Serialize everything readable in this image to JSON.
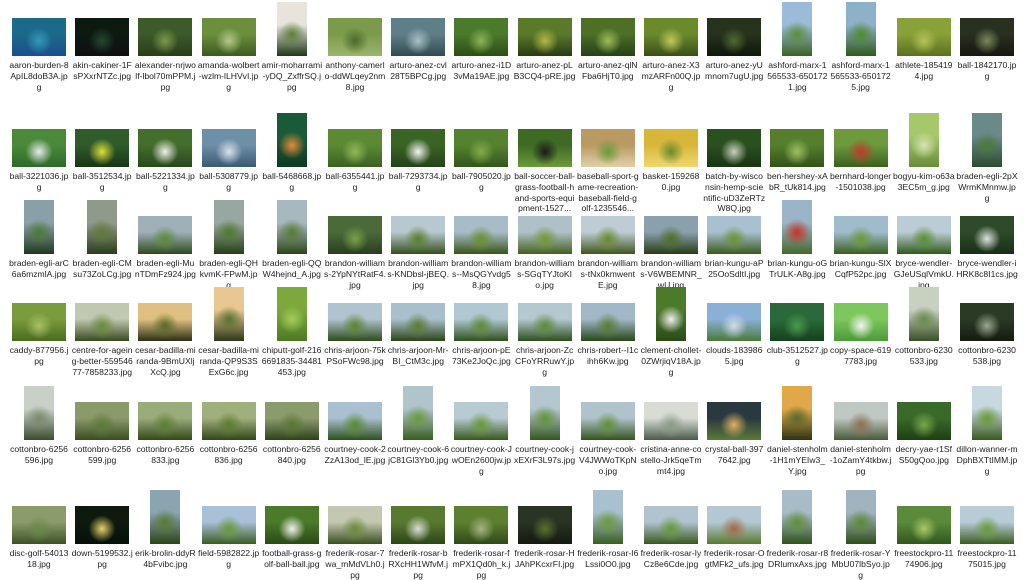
{
  "window": {
    "title": ""
  },
  "files": [
    [
      {
        "name": "aaron-burden-8ApIL8doB3A.jpg",
        "c": [
          "#1b6a8a",
          "#2f9bb8",
          "#1d4d8c"
        ],
        "o": "l"
      },
      {
        "name": "akin-cakiner-1FsPXxrNTZc.jpg",
        "c": [
          "#0c1a12",
          "#234830",
          "#0e0f10"
        ],
        "o": "l"
      },
      {
        "name": "alexander-nrjwolf-lbol70mPPM.jpg",
        "c": [
          "#3c5a2a",
          "#7b9a4a",
          "#2a3d1a"
        ],
        "o": "l"
      },
      {
        "name": "amanda-wolbert-wzlm-lLHVvI.jpg",
        "c": [
          "#6c8f3d",
          "#b5c98a",
          "#3d5a20"
        ],
        "o": "l"
      },
      {
        "name": "amir-moharrami-yDQ_ZxffrSQ.jpg",
        "c": [
          "#e8e4dc",
          "#5e7f3b",
          "#203818"
        ],
        "o": "p"
      },
      {
        "name": "anthony-camerlo-ddWLqey2nm8.jpg",
        "c": [
          "#7c9a4c",
          "#4a6a2a",
          "#9bb56c"
        ],
        "o": "l"
      },
      {
        "name": "arturo-anez-cvl28T5BPCg.jpg",
        "c": [
          "#5f7f88",
          "#a9c1c7",
          "#314a50"
        ],
        "o": "l"
      },
      {
        "name": "arturo-anez-i1D3vMa19AE.jpg",
        "c": [
          "#4a7a2a",
          "#8db45a",
          "#2e4d16"
        ],
        "o": "l"
      },
      {
        "name": "arturo-anez-pLB3CQ4-pRE.jpg",
        "c": [
          "#5a7a2a",
          "#b3b84a",
          "#2a3a14"
        ],
        "o": "l"
      },
      {
        "name": "arturo-anez-qlNFba6HjT0.jpg",
        "c": [
          "#4d6f26",
          "#9fbd5a",
          "#26401a"
        ],
        "o": "l"
      },
      {
        "name": "arturo-anez-X3mzARFn00Q.jpg",
        "c": [
          "#6b8a2c",
          "#c1c85a",
          "#3a4d1a"
        ],
        "o": "l"
      },
      {
        "name": "arturo-anez-yUmnom7ugU.jpg",
        "c": [
          "#27331c",
          "#4e6a2e",
          "#0f160b"
        ],
        "o": "l"
      },
      {
        "name": "ashford-marx-1565533-6501721.jpg",
        "c": [
          "#9bbbd8",
          "#5c8d3a",
          "#3a6224"
        ],
        "o": "p"
      },
      {
        "name": "ashford-marx-1565533-6501725.jpg",
        "c": [
          "#8fb0c9",
          "#4f8a30",
          "#2f5a1c"
        ],
        "o": "p"
      },
      {
        "name": "athlete-1854194.jpg",
        "c": [
          "#8aa038",
          "#b7c25a",
          "#5a7020"
        ],
        "o": "l"
      },
      {
        "name": "ball-1842170.jpg",
        "c": [
          "#2a3020",
          "#7a8a58",
          "#15180f"
        ],
        "o": "l"
      }
    ],
    [
      {
        "name": "ball-3221036.jpg",
        "c": [
          "#4a8a3a",
          "#e6ecef",
          "#2f6a2a"
        ],
        "o": "l"
      },
      {
        "name": "ball-3512534.jpg",
        "c": [
          "#2f5c2a",
          "#d9e03a",
          "#1a3416"
        ],
        "o": "l"
      },
      {
        "name": "ball-5221334.jpg",
        "c": [
          "#446e2c",
          "#f0f0ea",
          "#29481a"
        ],
        "o": "l"
      },
      {
        "name": "ball-5308779.jpg",
        "c": [
          "#6e8fa8",
          "#d8e2ea",
          "#3a5a74"
        ],
        "o": "l"
      },
      {
        "name": "ball-5468668.jpg",
        "c": [
          "#1a5a38",
          "#e58a3a",
          "#0e3a22"
        ],
        "o": "p"
      },
      {
        "name": "ball-6355441.jpg",
        "c": [
          "#5c8a34",
          "#8fb85a",
          "#3c6020"
        ],
        "o": "l"
      },
      {
        "name": "ball-7293734.jpg",
        "c": [
          "#3a6424",
          "#f4f4f0",
          "#24421a"
        ],
        "o": "l"
      },
      {
        "name": "ball-7905020.jpg",
        "c": [
          "#55822e",
          "#83ab4c",
          "#33561c"
        ],
        "o": "l"
      },
      {
        "name": "ball-soccer-ball-grass-football-hand-sports-equipment-1527...",
        "c": [
          "#3e6a24",
          "#1a1a1a",
          "#6c9a3c"
        ],
        "o": "l"
      },
      {
        "name": "baseball-sport-game-recreation-baseball-field-golf-1235546...",
        "c": [
          "#b89a62",
          "#6a9a3a",
          "#e0d0a6"
        ],
        "o": "l"
      },
      {
        "name": "basket-1592680.jpg",
        "c": [
          "#d8b63a",
          "#6a8a2a",
          "#f0d870"
        ],
        "o": "l"
      },
      {
        "name": "batch-by-wisconsin-hemp-scientific-uD3ZeRTzW8Q.jpg",
        "c": [
          "#2a5020",
          "#c8d0c0",
          "#183414"
        ],
        "o": "l"
      },
      {
        "name": "ben-hershey-xAbR_tUk814.jpg",
        "c": [
          "#567e2c",
          "#9ec064",
          "#34521a"
        ],
        "o": "l"
      },
      {
        "name": "bernhard-longer-1501038.jpg",
        "c": [
          "#6c9a3c",
          "#c23a2a",
          "#3c6020"
        ],
        "o": "l"
      },
      {
        "name": "bogyu-kim-o63a3EC5m_g.jpg",
        "c": [
          "#a6c86a",
          "#d6e6b0",
          "#6a8c3a"
        ],
        "o": "p"
      },
      {
        "name": "braden-egli-2pXWrmKMnmw.jpg",
        "c": [
          "#6a8a8a",
          "#4a7a3a",
          "#2c4a2c"
        ],
        "o": "p"
      }
    ],
    [
      {
        "name": "braden-egli-arC6a6mzmlA.jpg",
        "c": [
          "#8aa0a8",
          "#4c7a34",
          "#203820"
        ],
        "o": "p"
      },
      {
        "name": "braden-egli-CMsu73ZoLCg.jpg",
        "c": [
          "#909a8a",
          "#5e7a3a",
          "#2a3c1c"
        ],
        "o": "p"
      },
      {
        "name": "braden-egli-MunTDmFz924.jpg",
        "c": [
          "#a0b0b8",
          "#5e8a3c",
          "#2e4a1c"
        ],
        "o": "l"
      },
      {
        "name": "braden-egli-QHkvmK-FPwM.jpg",
        "c": [
          "#98a8a0",
          "#4e7a30",
          "#263e18"
        ],
        "o": "p"
      },
      {
        "name": "braden-egli-QQW4hejnd_A.jpg",
        "c": [
          "#a8b8c0",
          "#567c32",
          "#2c461a"
        ],
        "o": "p"
      },
      {
        "name": "brandon-williams-2YpNYtRatF4.jpg",
        "c": [
          "#4a6a3a",
          "#7aa04c",
          "#2a3e1e"
        ],
        "o": "l"
      },
      {
        "name": "brandon-williams-KNDbsl-jBEQ.jpg",
        "c": [
          "#b8c8d0",
          "#5a7e2e",
          "#34501a"
        ],
        "o": "l"
      },
      {
        "name": "brandon-williams--MsQGYvdg58.jpg",
        "c": [
          "#a8bcc8",
          "#6a9030",
          "#3a5418"
        ],
        "o": "l"
      },
      {
        "name": "brandon-williams-SGqTYJtoKIo.jpg",
        "c": [
          "#b0c0c8",
          "#74983a",
          "#44601e"
        ],
        "o": "l"
      },
      {
        "name": "brandon-williams-tNx0kmwentE.jpg",
        "c": [
          "#c0ccd4",
          "#6a8a34",
          "#3e561c"
        ],
        "o": "l"
      },
      {
        "name": "brandon-williams-V6WBEMNR_wU.jpg",
        "c": [
          "#8aa0ac",
          "#4e6e2a",
          "#283c16"
        ],
        "o": "l"
      },
      {
        "name": "brian-kungu-aP25OoSdltI.jpg",
        "c": [
          "#a8c0d0",
          "#6a9438",
          "#3a5a1c"
        ],
        "o": "l"
      },
      {
        "name": "brian-kungu-oGTrULK-A8g.jpg",
        "c": [
          "#9ab4c8",
          "#c8302a",
          "#44682a"
        ],
        "o": "p"
      },
      {
        "name": "brian-kungu-SlXCqfP52pc.jpg",
        "c": [
          "#a0bccc",
          "#6c9a3c",
          "#3a5e20"
        ],
        "o": "l"
      },
      {
        "name": "bryce-wendler-GJeUSqlVmkU.jpg",
        "c": [
          "#bcccd6",
          "#5a8e34",
          "#2e5a1a"
        ],
        "o": "l"
      },
      {
        "name": "bryce-wendler-iHRK8c8I1cs.jpg",
        "c": [
          "#2e4a2a",
          "#dce4dc",
          "#1a2c18"
        ],
        "o": "l"
      }
    ],
    [
      {
        "name": "caddy-877956.jpg",
        "c": [
          "#7a9c3c",
          "#a8c064",
          "#4a6a20"
        ],
        "o": "l"
      },
      {
        "name": "centre-for-ageing-better-55954677-7858233.jpg",
        "c": [
          "#c0c8b0",
          "#6a8a3a",
          "#3a4a20"
        ],
        "o": "l"
      },
      {
        "name": "cesar-badilla-miranda-9BmUXljXcQ.jpg",
        "c": [
          "#e0c080",
          "#5a6a2a",
          "#2a3014"
        ],
        "o": "l"
      },
      {
        "name": "cesar-badilla-miranda-QP9S3SExG6c.jpg",
        "c": [
          "#e8c890",
          "#5a7030",
          "#2c3818"
        ],
        "o": "p"
      },
      {
        "name": "chiputt-golf-2166691835-34481453.jpg",
        "c": [
          "#7ca83c",
          "#a8cc5c",
          "#4c7a24"
        ],
        "o": "p"
      },
      {
        "name": "chris-arjoon-75kPSoFWc98.jpg",
        "c": [
          "#b0c4d0",
          "#5c8430",
          "#2e4a1a"
        ],
        "o": "l"
      },
      {
        "name": "chris-arjoon-Mr-BI_CtM3c.jpg",
        "c": [
          "#a8c0cc",
          "#5a7a34",
          "#2c4418"
        ],
        "o": "l"
      },
      {
        "name": "chris-arjoon-pE73Ke2JoQc.jpg",
        "c": [
          "#b0c8d4",
          "#608a34",
          "#30501c"
        ],
        "o": "l"
      },
      {
        "name": "chris-arjoon-ZcCFoYRRuwY.jpg",
        "c": [
          "#b4c8d0",
          "#5e8a3a",
          "#2e4e1e"
        ],
        "o": "l"
      },
      {
        "name": "chris-robert--I1cihh6Kw.jpg",
        "c": [
          "#a0b8c8",
          "#587e30",
          "#2a461a"
        ],
        "o": "l"
      },
      {
        "name": "clement-chollet-0ZWrjiqV18A.jpg",
        "c": [
          "#4a7a2a",
          "#f0f0ec",
          "#2a4a18"
        ],
        "o": "p"
      },
      {
        "name": "clouds-1839865.jpg",
        "c": [
          "#8ab0d8",
          "#d0dce8",
          "#4a7a3a"
        ],
        "o": "l"
      },
      {
        "name": "club-3512527.jpg",
        "c": [
          "#2a6a3a",
          "#4a9a4c",
          "#16401e"
        ],
        "o": "l"
      },
      {
        "name": "copy-space-6197783.jpg",
        "c": [
          "#7cc85c",
          "#f4f4f0",
          "#4c9a3a"
        ],
        "o": "l"
      },
      {
        "name": "cottonbro-6230533.jpg",
        "c": [
          "#c8d0c0",
          "#6a8a4a",
          "#3a5028"
        ],
        "o": "p"
      },
      {
        "name": "cottonbro-6230538.jpg",
        "c": [
          "#2a3a24",
          "#9aa890",
          "#141c10"
        ],
        "o": "l"
      }
    ],
    [
      {
        "name": "cottonbro-6256596.jpg",
        "c": [
          "#c8d0c8",
          "#7a8a6a",
          "#3c4c30"
        ],
        "o": "p"
      },
      {
        "name": "cottonbro-6256599.jpg",
        "c": [
          "#8a9a6a",
          "#5c7a3a",
          "#3a4c22"
        ],
        "o": "l"
      },
      {
        "name": "cottonbro-6256833.jpg",
        "c": [
          "#9aac7a",
          "#5e7e34",
          "#34481c"
        ],
        "o": "l"
      },
      {
        "name": "cottonbro-6256836.jpg",
        "c": [
          "#a0b07c",
          "#5c7c30",
          "#32461a"
        ],
        "o": "l"
      },
      {
        "name": "cottonbro-6256840.jpg",
        "c": [
          "#8a9c6c",
          "#587834",
          "#30421c"
        ],
        "o": "l"
      },
      {
        "name": "courtney-cook-2ZzA13od_lE.jpg",
        "c": [
          "#aac0d0",
          "#5a8a34",
          "#2e501c"
        ],
        "o": "l"
      },
      {
        "name": "courtney-cook-6jC81Gl3Yb0.jpg",
        "c": [
          "#b0c4cc",
          "#6a9a3c",
          "#3a5e20"
        ],
        "o": "p"
      },
      {
        "name": "courtney-cook-JwOEn2600jw.jpg",
        "c": [
          "#b8cad2",
          "#68983a",
          "#38581e"
        ],
        "o": "l"
      },
      {
        "name": "courtney-cook-jxEXrF3L97s.jpg",
        "c": [
          "#b4c6d0",
          "#64943a",
          "#36581e"
        ],
        "o": "p"
      },
      {
        "name": "courtney-cook-V4JWWoTKpNo.jpg",
        "c": [
          "#b0c2cc",
          "#62903a",
          "#34541e"
        ],
        "o": "l"
      },
      {
        "name": "cristina-anne-costello-Jrk5qeTmmt4.jpg",
        "c": [
          "#d8dcd4",
          "#8a9a8a",
          "#4a5a4a"
        ],
        "o": "l"
      },
      {
        "name": "crystal-ball-3977642.jpg",
        "c": [
          "#2a3840",
          "#e0b060",
          "#5a7a3a"
        ],
        "o": "l"
      },
      {
        "name": "daniel-stenholm-1H1mYEIw3_Y.jpg",
        "c": [
          "#e0a848",
          "#5a6a2c",
          "#2c3414"
        ],
        "o": "p"
      },
      {
        "name": "daniel-stenholm-1oZamY4tkbw.jpg",
        "c": [
          "#c0c8c4",
          "#8a7050",
          "#4a5a3a"
        ],
        "o": "l"
      },
      {
        "name": "decry-yae-r1SfS50gQoo.jpg",
        "c": [
          "#3a6a2a",
          "#78a84a",
          "#1e3e14"
        ],
        "o": "l"
      },
      {
        "name": "dillon-wanner-mDphBXTtIMM.jpg",
        "c": [
          "#c8d8e0",
          "#6a9a3a",
          "#3a5a20"
        ],
        "o": "p"
      }
    ],
    [
      {
        "name": "disc-golf-5401318.jpg",
        "c": [
          "#8a9c6a",
          "#6a8a4a",
          "#3e5028"
        ],
        "o": "l"
      },
      {
        "name": "down-5199532.jpg",
        "c": [
          "#0e1a0e",
          "#e6d26a",
          "#06100a"
        ],
        "o": "l"
      },
      {
        "name": "erik-brolin-ddyR4bFvibc.jpg",
        "c": [
          "#8aa4b0",
          "#5a7a34",
          "#2c4418"
        ],
        "o": "p"
      },
      {
        "name": "field-5982822.jpg",
        "c": [
          "#a8c0d8",
          "#6a9a3a",
          "#3a5e20"
        ],
        "o": "l"
      },
      {
        "name": "football-grass-golf-ball-ball.jpg",
        "c": [
          "#4a7a2a",
          "#f2f2ee",
          "#2a4a18"
        ],
        "o": "l"
      },
      {
        "name": "frederik-rosar-7wa_mMdVLh0.jpg",
        "c": [
          "#c4c8b0",
          "#6a8a3a",
          "#3a5020"
        ],
        "o": "l"
      },
      {
        "name": "frederik-rosar-bRXcHH1WfvM.jpg",
        "c": [
          "#587a30",
          "#dcdcd4",
          "#2e4418"
        ],
        "o": "l"
      },
      {
        "name": "frederik-rosar-fmPX1Qd0h_k.jpg",
        "c": [
          "#5c8030",
          "#a8b480",
          "#304818"
        ],
        "o": "l"
      },
      {
        "name": "frederik-rosar-HJAhPKcxrFI.jpg",
        "c": [
          "#2a3424",
          "#5a7030",
          "#141a10"
        ],
        "o": "l"
      },
      {
        "name": "frederik-rosar-I6Lssi0O0.jpg",
        "c": [
          "#a8c0d0",
          "#6a9a3c",
          "#3a5e20"
        ],
        "o": "p"
      },
      {
        "name": "frederik-rosar-IyCz8e6Cde.jpg",
        "c": [
          "#b0c4d0",
          "#68983a",
          "#38581e"
        ],
        "o": "l"
      },
      {
        "name": "frederik-rosar-OgtMFk2_ufs.jpg",
        "c": [
          "#b4c8d4",
          "#a06a4a",
          "#587a30"
        ],
        "o": "l"
      },
      {
        "name": "frederik-rosar-r8DRlumxAxs.jpg",
        "c": [
          "#a8bcc8",
          "#609038",
          "#30521c"
        ],
        "o": "p"
      },
      {
        "name": "frederik-rosar-YMbU07lbSyo.jpg",
        "c": [
          "#a0b4c0",
          "#5e8a36",
          "#2e4e1a"
        ],
        "o": "p"
      },
      {
        "name": "freestockpro-1174906.jpg",
        "c": [
          "#5a8a3a",
          "#a8c86a",
          "#32561c"
        ],
        "o": "l"
      },
      {
        "name": "freestockpro-1175015.jpg",
        "c": [
          "#b8ccd8",
          "#6a9a3c",
          "#3a5e20"
        ],
        "o": "l"
      }
    ]
  ]
}
